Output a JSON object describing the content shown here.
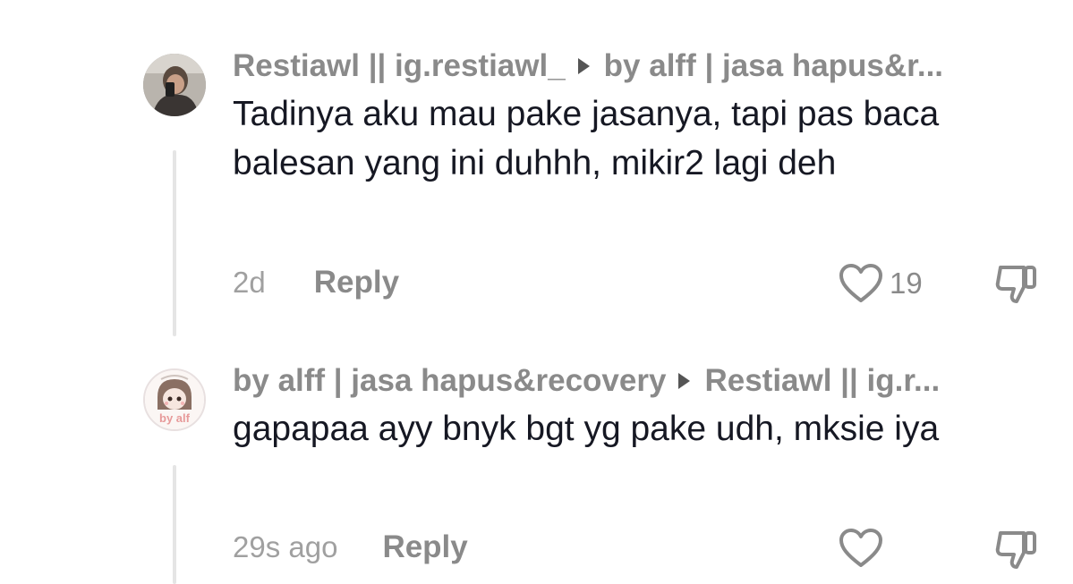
{
  "comments": [
    {
      "author": "Restiawl || ig.restiawl_",
      "reply_to": "by alff | jasa hapus&r...",
      "text": "Tadinya aku mau pake jasanya, tapi pas baca balesan yang ini duhhh, mikir2 lagi deh",
      "time": "2d",
      "reply_label": "Reply",
      "likes": "19"
    },
    {
      "author": "by alff | jasa hapus&recovery",
      "reply_to": "Restiawl || ig.r...",
      "text": "gapapaa ayy bnyk bgt yg pake udh, mksie iya",
      "time": "29s ago",
      "reply_label": "Reply",
      "likes": "",
      "avatar_text": "by alf"
    }
  ],
  "icons": {
    "like": "heart-outline-icon",
    "dislike": "thumbs-down-outline-icon",
    "separator": "caret-right-icon"
  },
  "colors": {
    "text": "#161823",
    "muted": "#8a8a8a",
    "thread_line": "#e5e5e5"
  }
}
